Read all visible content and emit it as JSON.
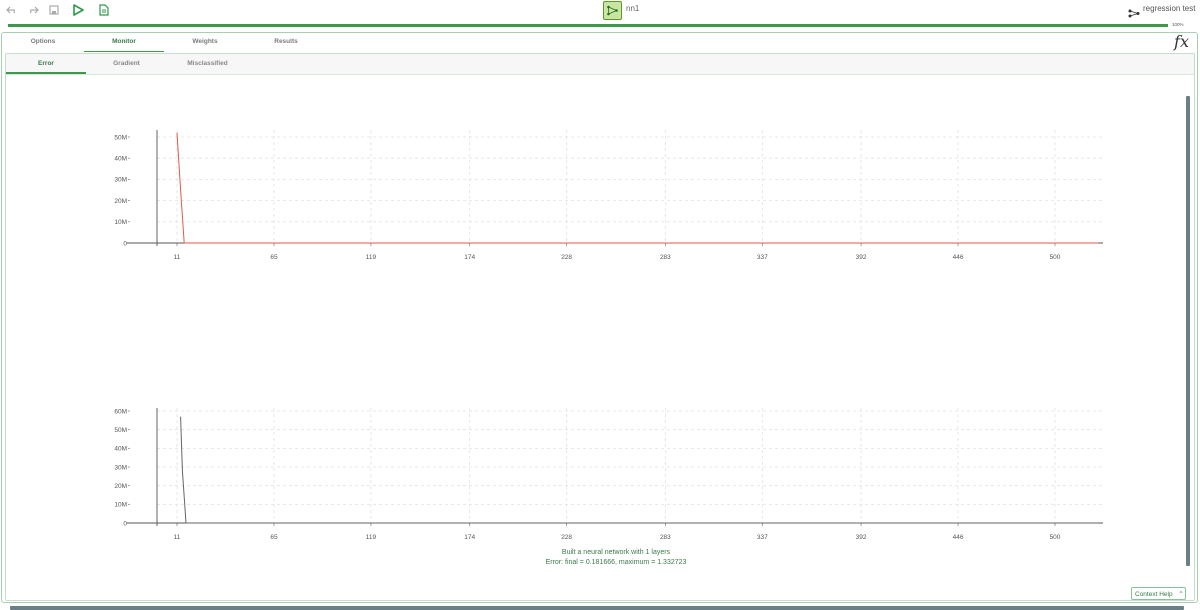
{
  "toolbar": {
    "node_name": "nn1",
    "project_name": "regression test"
  },
  "progress": {
    "value": 1.0,
    "label": "100%"
  },
  "tabs_main": [
    "Options",
    "Monitor",
    "Weights",
    "Results"
  ],
  "tabs_main_active": "Monitor",
  "tabs_sub": [
    "Error",
    "Gradient",
    "Misclassified"
  ],
  "tabs_sub_active": "Error",
  "colors": {
    "accent": "#3a9a4a",
    "series_top": "#e05a4a",
    "series_bottom": "#666666"
  },
  "summary": {
    "line1": "Built a neural network with 1 layers",
    "line2": "Error: final = 0.181666, maximum = 1.332723"
  },
  "context_help": "Context Help",
  "chart_data": [
    {
      "type": "line",
      "x_ticks": [
        11,
        65,
        119,
        174,
        228,
        283,
        337,
        392,
        446,
        500
      ],
      "y_ticks": [
        "0",
        "10M",
        "20M",
        "30M",
        "40M",
        "50M"
      ],
      "xlim": [
        0,
        524
      ],
      "ylim": [
        0,
        55000000
      ],
      "grid": true,
      "series": [
        {
          "x": [
            11,
            13,
            15,
            524
          ],
          "y": [
            52000000,
            25000000,
            0,
            0
          ]
        }
      ]
    },
    {
      "type": "line",
      "x_ticks": [
        11,
        65,
        119,
        174,
        228,
        283,
        337,
        392,
        446,
        500
      ],
      "y_ticks": [
        "0",
        "10M",
        "20M",
        "30M",
        "40M",
        "50M",
        "60M"
      ],
      "xlim": [
        0,
        524
      ],
      "ylim": [
        0,
        60000000
      ],
      "grid": true,
      "series": [
        {
          "x": [
            13,
            14,
            16,
            524
          ],
          "y": [
            57000000,
            28000000,
            0,
            0
          ]
        }
      ]
    }
  ]
}
